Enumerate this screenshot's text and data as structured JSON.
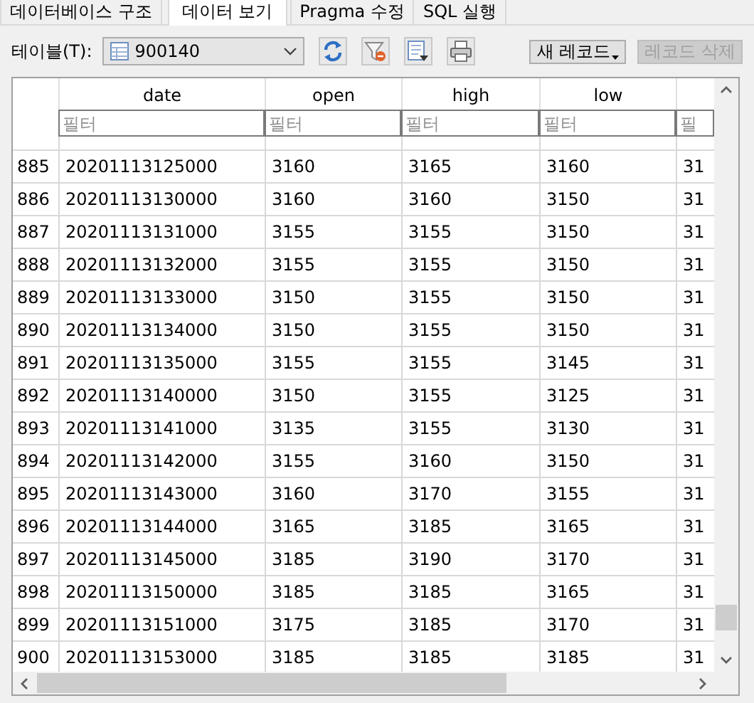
{
  "tabs": [
    {
      "label": "데이터베이스 구조",
      "selected": false
    },
    {
      "label": "데이터 보기",
      "selected": true
    },
    {
      "label": "Pragma 수정",
      "selected": false
    },
    {
      "label": "SQL 실행",
      "selected": false
    }
  ],
  "toolbar": {
    "table_label": "테이블(T):",
    "table_select": {
      "value": "900140"
    },
    "buttons": [
      {
        "label": "새 레코드",
        "disabled": false,
        "dropdown": true
      },
      {
        "label": "레코드 삭제",
        "disabled": true,
        "dropdown": false
      }
    ]
  },
  "table": {
    "columns": [
      {
        "header": "date",
        "filter_placeholder": "필터"
      },
      {
        "header": "open",
        "filter_placeholder": "필터"
      },
      {
        "header": "high",
        "filter_placeholder": "필터"
      },
      {
        "header": "low",
        "filter_placeholder": "필터"
      },
      {
        "filter_placeholder": "필"
      }
    ],
    "rows": [
      {
        "number": "885",
        "cells": [
          "20201113125000",
          "3160",
          "3165",
          "3160",
          "31"
        ]
      },
      {
        "number": "886",
        "cells": [
          "20201113130000",
          "3160",
          "3160",
          "3150",
          "31"
        ]
      },
      {
        "number": "887",
        "cells": [
          "20201113131000",
          "3155",
          "3155",
          "3150",
          "31"
        ]
      },
      {
        "number": "888",
        "cells": [
          "20201113132000",
          "3155",
          "3155",
          "3150",
          "31"
        ]
      },
      {
        "number": "889",
        "cells": [
          "20201113133000",
          "3150",
          "3155",
          "3150",
          "31"
        ]
      },
      {
        "number": "890",
        "cells": [
          "20201113134000",
          "3150",
          "3155",
          "3150",
          "31"
        ]
      },
      {
        "number": "891",
        "cells": [
          "20201113135000",
          "3155",
          "3155",
          "3145",
          "31"
        ]
      },
      {
        "number": "892",
        "cells": [
          "20201113140000",
          "3150",
          "3155",
          "3125",
          "31"
        ]
      },
      {
        "number": "893",
        "cells": [
          "20201113141000",
          "3135",
          "3155",
          "3130",
          "31"
        ]
      },
      {
        "number": "894",
        "cells": [
          "20201113142000",
          "3155",
          "3160",
          "3150",
          "31"
        ]
      },
      {
        "number": "895",
        "cells": [
          "20201113143000",
          "3160",
          "3170",
          "3155",
          "31"
        ]
      },
      {
        "number": "896",
        "cells": [
          "20201113144000",
          "3165",
          "3185",
          "3165",
          "31"
        ]
      },
      {
        "number": "897",
        "cells": [
          "20201113145000",
          "3185",
          "3190",
          "3170",
          "31"
        ]
      },
      {
        "number": "898",
        "cells": [
          "20201113150000",
          "3185",
          "3185",
          "3165",
          "31"
        ]
      },
      {
        "number": "899",
        "cells": [
          "20201113151000",
          "3175",
          "3185",
          "3170",
          "31"
        ]
      },
      {
        "number": "900",
        "cells": [
          "20201113153000",
          "3185",
          "3185",
          "3185",
          "31"
        ]
      }
    ]
  }
}
